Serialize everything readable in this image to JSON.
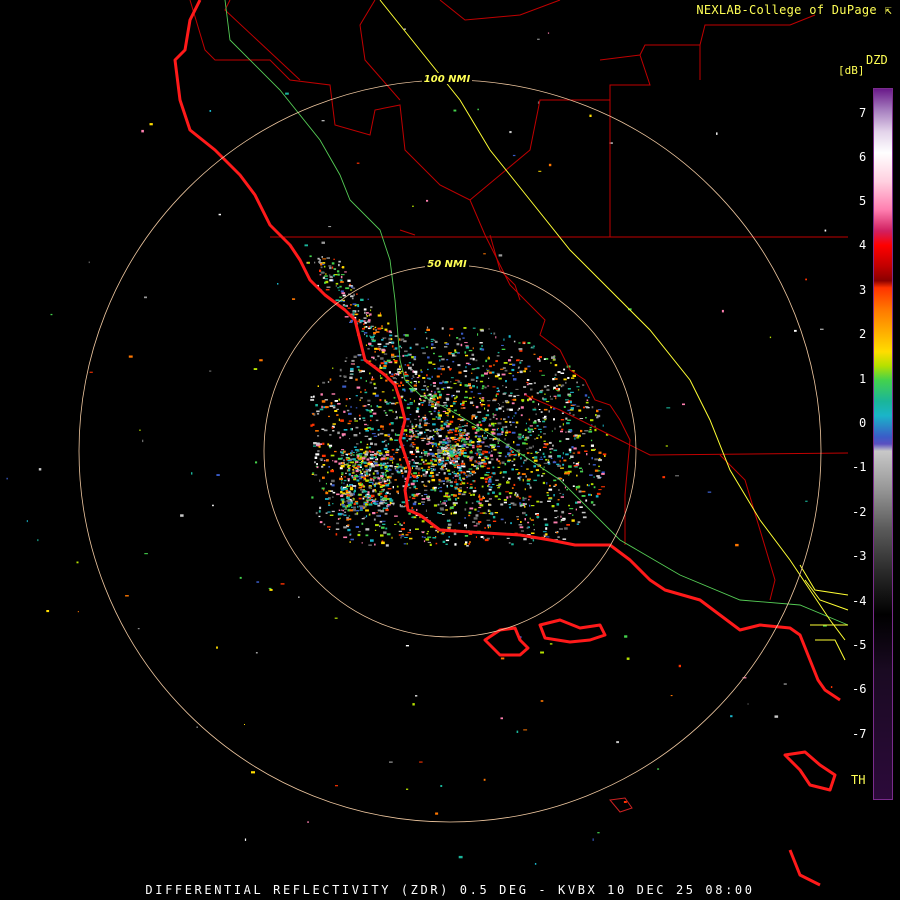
{
  "credit": "NEXLAB-College of DuPage",
  "caption": "DIFFERENTIAL REFLECTIVITY (ZDR) 0.5 DEG - KVBX 10 DEC 25 08:00",
  "colorbar": {
    "product": "DZD",
    "unit": "[dB]",
    "labels": [
      "7",
      "6",
      "5",
      "4",
      "3",
      "2",
      "1",
      "0",
      "-1",
      "-2",
      "-3",
      "-4",
      "-5",
      "-6",
      "-7"
    ],
    "th_label": "TH"
  },
  "range_rings": [
    {
      "label": "50 NMI"
    },
    {
      "label": "100 NMI"
    }
  ],
  "colors": {
    "coastline": "#ff1a1a",
    "county_lines": "#c00000",
    "highway": "#ffff33",
    "rivers": "#66dd66",
    "rings": "#f0c8a0"
  },
  "icons": {
    "credit_icon": "cursor-icon"
  }
}
